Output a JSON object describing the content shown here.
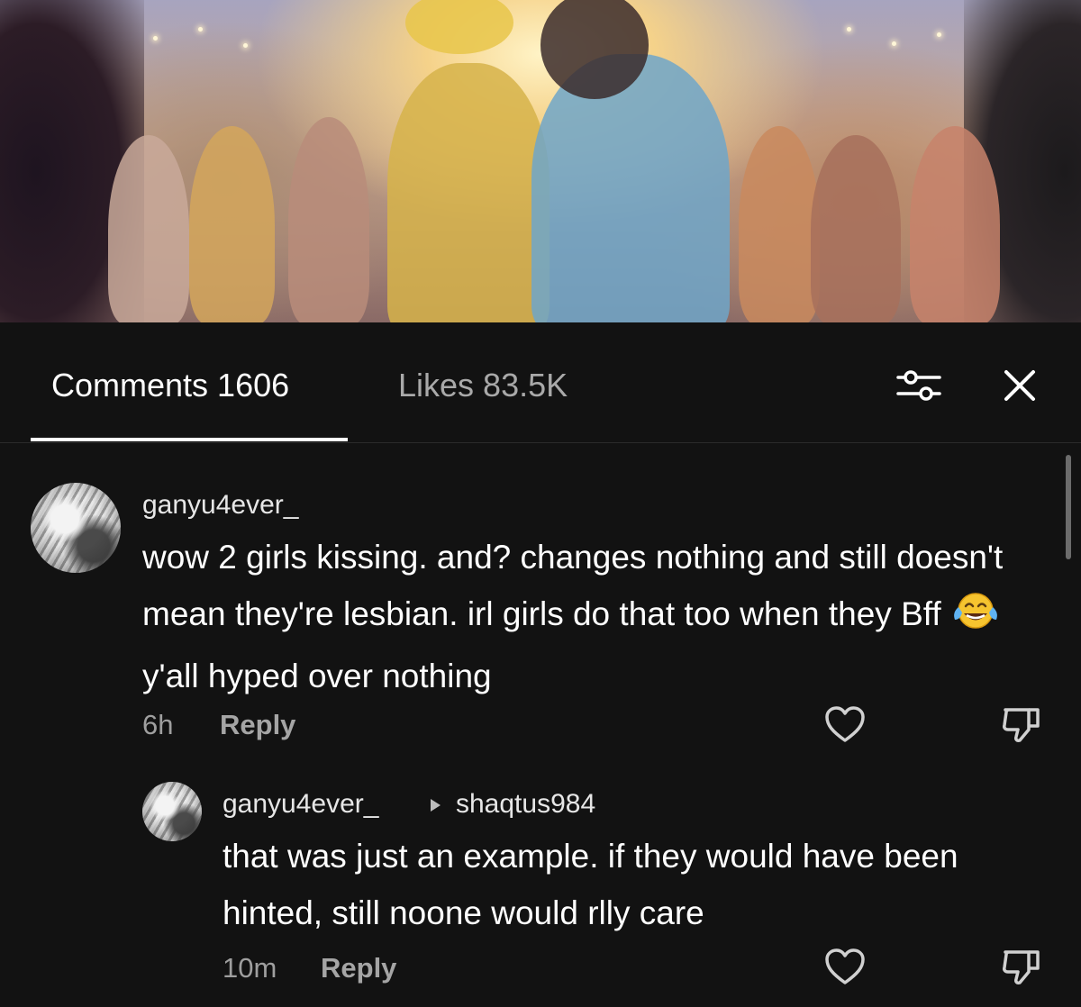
{
  "tabs": {
    "comments_label": "Comments 1606",
    "likes_label": "Likes 83.5K"
  },
  "icons": {
    "filter": "sliders-icon",
    "close": "close-icon",
    "like": "heart-outline-icon",
    "dislike": "thumbs-down-icon",
    "reply_arrow": "triangle-right-icon",
    "emoji": "face-with-tears-of-joy-emoji"
  },
  "comments": [
    {
      "username": "ganyu4ever_",
      "text_before_emoji": "wow 2 girls kissing. and? changes nothing and still doesn't mean they're lesbian. irl girls do that too when they Bff ",
      "text_after_emoji": "y'all hyped over nothing",
      "time": "6h",
      "reply_label": "Reply"
    },
    {
      "username": "ganyu4ever_",
      "reply_to": "shaqtus984",
      "text": "that was just an example. if they would have been hinted, still noone would rlly care",
      "time": "10m",
      "reply_label": "Reply"
    }
  ],
  "colors": {
    "background": "#121212",
    "text_primary": "#ffffff",
    "text_secondary": "#a9a9a9"
  }
}
